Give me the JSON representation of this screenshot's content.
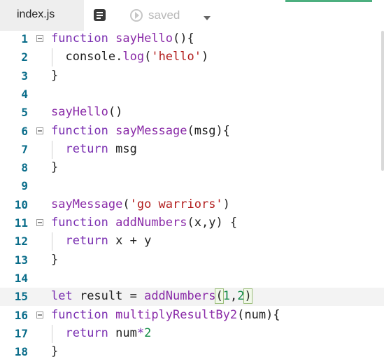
{
  "tab": {
    "filename": "index.js"
  },
  "toolbar": {
    "saved_label": "saved"
  },
  "colors": {
    "keyword": "#7a2fb1",
    "function": "#8a2ba8",
    "string": "#b21d1d",
    "number": "#108a44",
    "line_number": "#0a6d8a",
    "accent": "#4caf7f"
  },
  "editor": {
    "active_line": 15,
    "lines": [
      {
        "n": "1",
        "fold": true,
        "indent": false,
        "tokens": [
          [
            "kw",
            "function"
          ],
          [
            "t",
            " "
          ],
          [
            "fn",
            "sayHello"
          ],
          [
            "t",
            "(){"
          ]
        ]
      },
      {
        "n": "2",
        "fold": false,
        "indent": true,
        "tokens": [
          [
            "t",
            "  console."
          ],
          [
            "fn",
            "log"
          ],
          [
            "t",
            "("
          ],
          [
            "str",
            "'hello'"
          ],
          [
            "t",
            ")"
          ]
        ]
      },
      {
        "n": "3",
        "fold": false,
        "indent": false,
        "tokens": [
          [
            "t",
            "}"
          ]
        ]
      },
      {
        "n": "4",
        "fold": false,
        "indent": false,
        "tokens": []
      },
      {
        "n": "5",
        "fold": false,
        "indent": false,
        "tokens": [
          [
            "fn",
            "sayHello"
          ],
          [
            "t",
            "()"
          ]
        ]
      },
      {
        "n": "6",
        "fold": true,
        "indent": false,
        "tokens": [
          [
            "kw",
            "function"
          ],
          [
            "t",
            " "
          ],
          [
            "fn",
            "sayMessage"
          ],
          [
            "t",
            "(msg){"
          ]
        ]
      },
      {
        "n": "7",
        "fold": false,
        "indent": true,
        "tokens": [
          [
            "t",
            "  "
          ],
          [
            "kw",
            "return"
          ],
          [
            "t",
            " msg"
          ]
        ]
      },
      {
        "n": "8",
        "fold": false,
        "indent": false,
        "tokens": [
          [
            "t",
            "}"
          ]
        ]
      },
      {
        "n": "9",
        "fold": false,
        "indent": false,
        "tokens": []
      },
      {
        "n": "10",
        "fold": false,
        "indent": false,
        "tokens": [
          [
            "fn",
            "sayMessage"
          ],
          [
            "t",
            "("
          ],
          [
            "str",
            "'go warriors'"
          ],
          [
            "t",
            ")"
          ]
        ]
      },
      {
        "n": "11",
        "fold": true,
        "indent": false,
        "tokens": [
          [
            "kw",
            "function"
          ],
          [
            "t",
            " "
          ],
          [
            "fn",
            "addNumbers"
          ],
          [
            "t",
            "(x,y) {"
          ]
        ]
      },
      {
        "n": "12",
        "fold": false,
        "indent": true,
        "tokens": [
          [
            "t",
            "  "
          ],
          [
            "kw",
            "return"
          ],
          [
            "t",
            " x + y"
          ]
        ]
      },
      {
        "n": "13",
        "fold": false,
        "indent": false,
        "tokens": [
          [
            "t",
            "}"
          ]
        ]
      },
      {
        "n": "14",
        "fold": false,
        "indent": false,
        "tokens": []
      },
      {
        "n": "15",
        "fold": false,
        "indent": false,
        "tokens": [
          [
            "kw",
            "let"
          ],
          [
            "t",
            " result = "
          ],
          [
            "fn",
            "addNumbers"
          ],
          [
            "br",
            "("
          ],
          [
            "num",
            "1"
          ],
          [
            "t",
            ","
          ],
          [
            "num",
            "2"
          ],
          [
            "br",
            ")"
          ]
        ]
      },
      {
        "n": "16",
        "fold": true,
        "indent": false,
        "tokens": [
          [
            "kw",
            "function"
          ],
          [
            "t",
            " "
          ],
          [
            "fn",
            "multiplyResultBy2"
          ],
          [
            "t",
            "(num){"
          ]
        ]
      },
      {
        "n": "17",
        "fold": false,
        "indent": true,
        "tokens": [
          [
            "t",
            "  "
          ],
          [
            "kw",
            "return"
          ],
          [
            "t",
            " num"
          ],
          [
            "kw",
            "*"
          ],
          [
            "num",
            "2"
          ]
        ]
      },
      {
        "n": "18",
        "fold": false,
        "indent": false,
        "tokens": [
          [
            "t",
            "}"
          ]
        ]
      }
    ]
  }
}
